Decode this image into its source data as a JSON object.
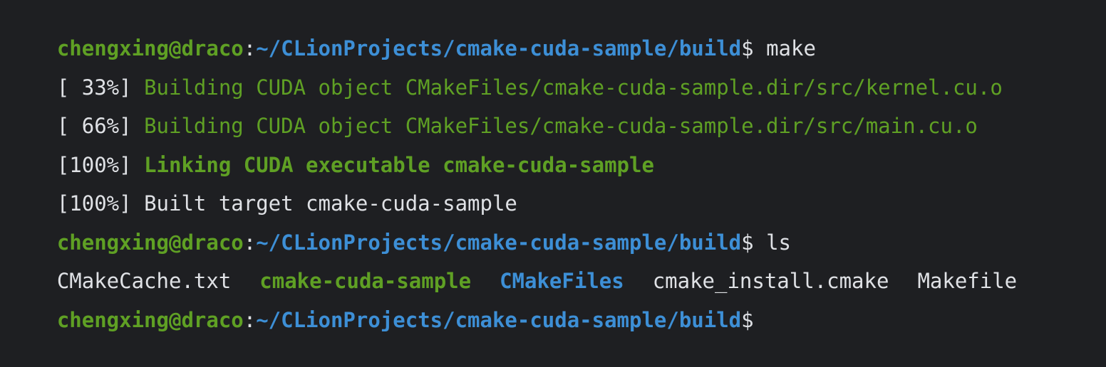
{
  "terminal": {
    "colors": {
      "background": "#1e1f22",
      "text": "#dfe1e5",
      "green": "#5fa024",
      "blue": "#3d8fd6"
    },
    "prompt": {
      "user_host": "chengxing@draco",
      "colon": ":",
      "path": "~/CLionProjects/cmake-cuda-sample/build",
      "symbol": "$"
    },
    "commands": {
      "make": " make",
      "ls": " ls"
    },
    "build_output": [
      {
        "percent": "[ 33%]",
        "message": "Building CUDA object CMakeFiles/cmake-cuda-sample.dir/src/kernel.cu.o"
      },
      {
        "percent": "[ 66%]",
        "message": "Building CUDA object CMakeFiles/cmake-cuda-sample.dir/src/main.cu.o"
      },
      {
        "percent": "[100%]",
        "message": "Linking CUDA executable cmake-cuda-sample"
      },
      {
        "percent": "[100%]",
        "message": "Built target cmake-cuda-sample"
      }
    ],
    "ls_output": [
      "CMakeCache.txt",
      "cmake-cuda-sample",
      "CMakeFiles",
      "cmake_install.cmake",
      "Makefile"
    ]
  }
}
